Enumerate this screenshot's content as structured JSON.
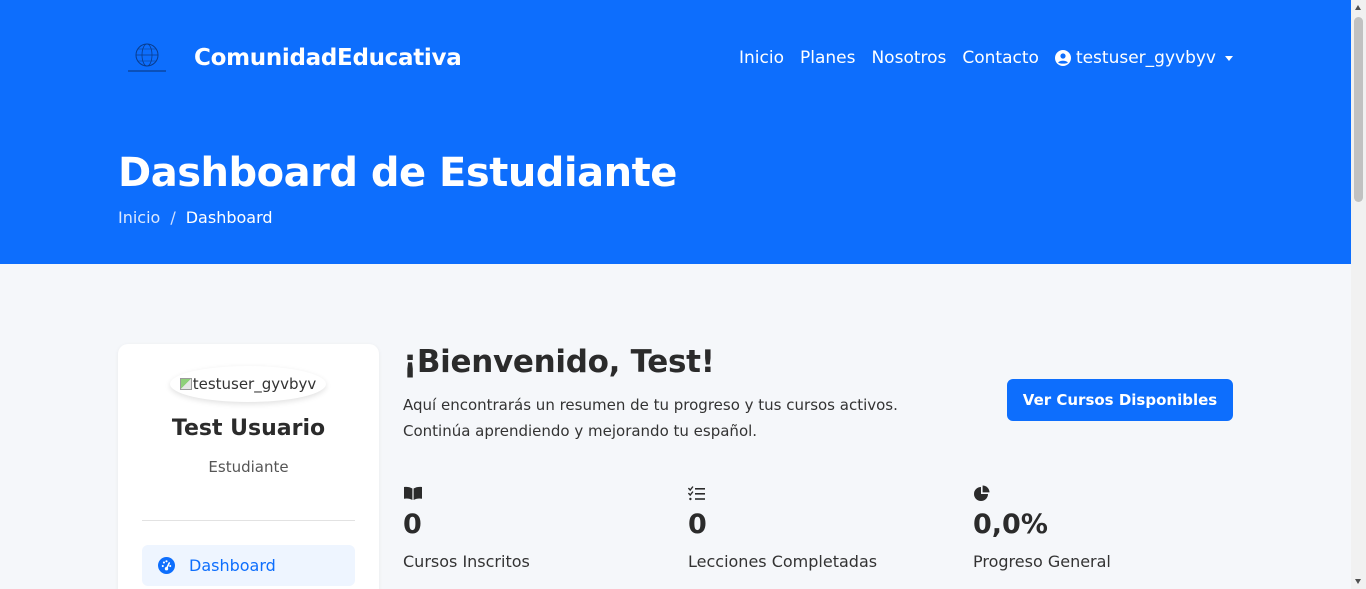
{
  "app": {
    "brand_name": "ComunidadEducativa",
    "accent_color": "#0d6efd",
    "logo_icon": "globe-logo-icon"
  },
  "nav": {
    "items": [
      {
        "label": "Inicio"
      },
      {
        "label": "Planes"
      },
      {
        "label": "Nosotros"
      },
      {
        "label": "Contacto"
      }
    ],
    "user": {
      "label": "testuser_gyvbyv",
      "icon": "user-circle-icon"
    }
  },
  "header": {
    "title": "Dashboard de Estudiante",
    "breadcrumb": [
      {
        "label": "Inicio"
      },
      {
        "label": "Dashboard"
      }
    ]
  },
  "profile": {
    "avatar_alt": "testuser_gyvbyv",
    "name": "Test Usuario",
    "role": "Estudiante",
    "menu": [
      {
        "label": "Dashboard",
        "icon": "gauge-icon",
        "active": true
      }
    ]
  },
  "welcome": {
    "title": "¡Bienvenido, Test!",
    "line1": "Aquí encontrarás un resumen de tu progreso y tus cursos activos.",
    "line2": "Continúa aprendiendo y mejorando tu español.",
    "cta_label": "Ver Cursos Disponibles"
  },
  "stats": [
    {
      "icon": "book-open-icon",
      "value": "0",
      "label": "Cursos Inscritos"
    },
    {
      "icon": "checklist-icon",
      "value": "0",
      "label": "Lecciones Completadas"
    },
    {
      "icon": "pie-chart-icon",
      "value": "0,0%",
      "label": "Progreso General"
    }
  ]
}
